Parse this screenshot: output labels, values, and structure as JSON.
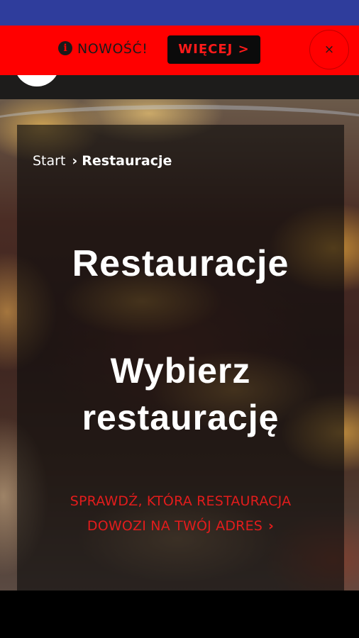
{
  "promo": {
    "info_icon": "i",
    "text": "NOWOŚĆ!",
    "button_label": "WIĘCEJ >",
    "close_label": "×"
  },
  "breadcrumb": {
    "home": "Start",
    "separator": "›",
    "current": "Restauracje"
  },
  "hero": {
    "title": "Restauracje",
    "subtitle": "Wybierz restaurację",
    "cta_text": "SPRAWDŹ, KTÓRA RESTAURACJA DOWOZI NA TWÓJ ADRES",
    "cta_arrow": "›"
  },
  "colors": {
    "status_bar": "#2f3d9c",
    "promo_bg": "#ff0000",
    "promo_button_bg": "#0b0b0b",
    "accent_red": "#e31c1c"
  }
}
